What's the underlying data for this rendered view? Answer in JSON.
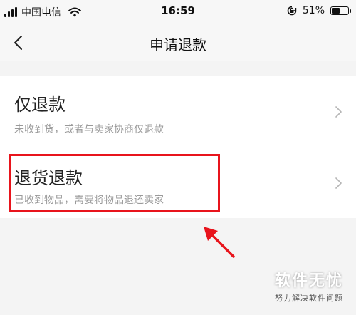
{
  "status_bar": {
    "carrier": "中国电信",
    "time": "16:59",
    "battery_percent": "51%",
    "battery_level": 0.51
  },
  "nav": {
    "title": "申请退款"
  },
  "options": [
    {
      "title": "仅退款",
      "subtitle": "未收到货，或者与卖家协商仅退款"
    },
    {
      "title": "退货退款",
      "subtitle": "已收到物品，需要将物品退还卖家"
    }
  ],
  "watermark": {
    "title": "软件无忧",
    "subtitle": "努力解决软件问题"
  },
  "colors": {
    "highlight": "#e8141c",
    "subtitle_text": "#9a9a9a",
    "background": "#f4f4f4"
  },
  "icons": {
    "signal": "signal-icon",
    "wifi": "wifi-icon",
    "lock_rotation": "orientation-lock-icon",
    "battery": "battery-icon",
    "back": "chevron-left-icon",
    "chevron": "chevron-right-icon"
  }
}
